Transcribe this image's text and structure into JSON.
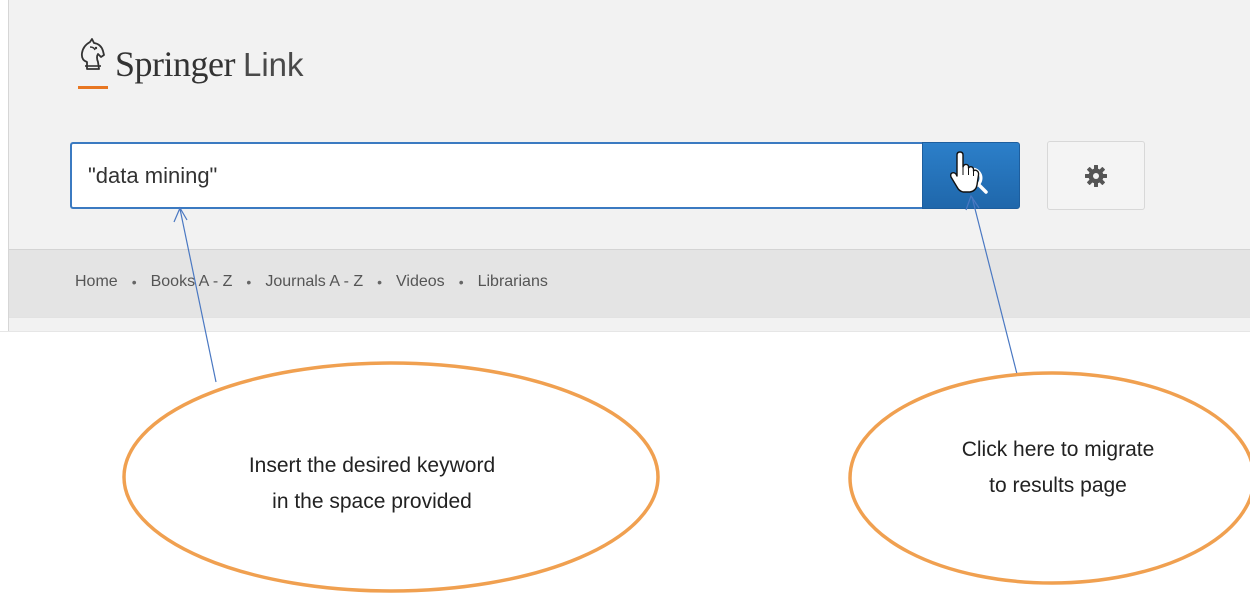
{
  "logo": {
    "brand_name": "Springer",
    "brand_suffix": "Link",
    "accent_color": "#e87722"
  },
  "search": {
    "value": "\"data mining\"",
    "button_icon": "search-icon",
    "settings_icon": "gear-icon"
  },
  "nav": {
    "items": [
      {
        "label": "Home"
      },
      {
        "label": "Books A - Z"
      },
      {
        "label": "Journals A - Z"
      },
      {
        "label": "Videos"
      },
      {
        "label": "Librarians"
      }
    ],
    "separator": "•"
  },
  "annotations": {
    "left_callout_line1": "Insert the desired keyword",
    "left_callout_line2": "in the space provided",
    "right_callout_line1": "Click here to migrate",
    "right_callout_line2": "to results page",
    "ellipse_color": "#f0a050",
    "arrow_color": "#4a78c2"
  },
  "colors": {
    "header_bg": "#f2f2f2",
    "nav_bg": "#e4e4e4",
    "search_button": "#2c7fc9",
    "input_border": "#3b7ac1"
  }
}
